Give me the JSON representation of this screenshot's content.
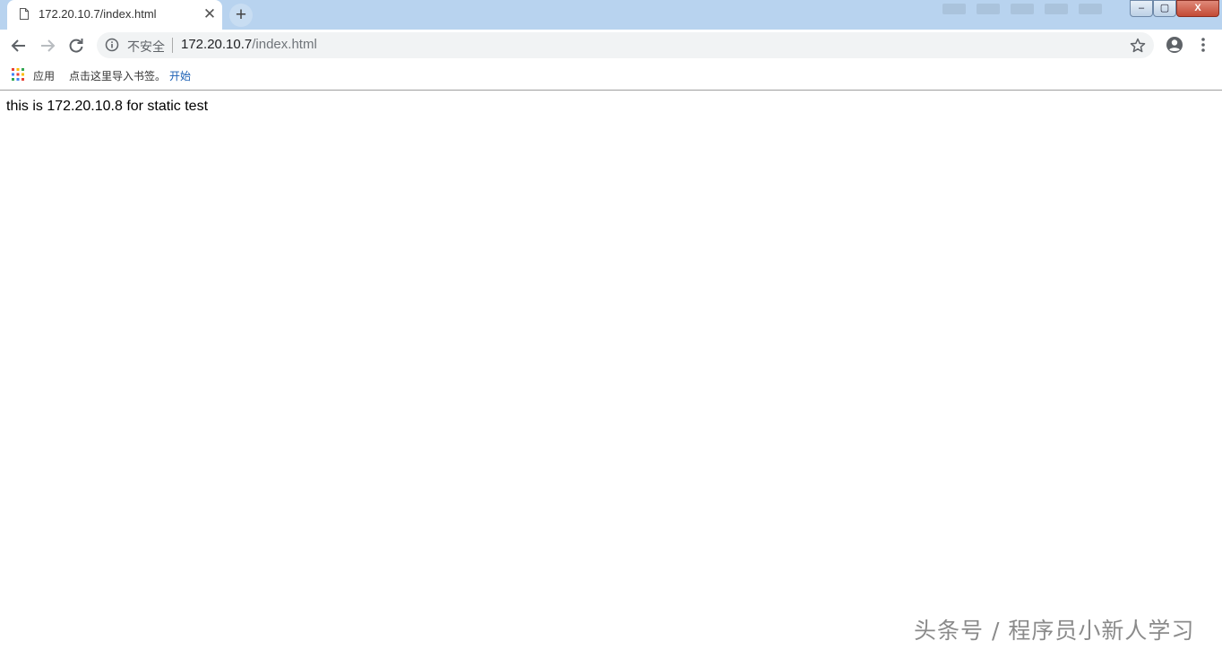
{
  "tab": {
    "title": "172.20.10.7/index.html",
    "close_glyph": "✕"
  },
  "new_tab_glyph": "+",
  "window_controls": {
    "minimize": "–",
    "maximize": "▢",
    "close": "X"
  },
  "omnibox": {
    "security_label": "不安全",
    "url_host": "172.20.10.7",
    "url_path": "/index.html"
  },
  "bookmarks": {
    "apps_label": "应用",
    "hint": "点击这里导入书签。",
    "start_link": "开始"
  },
  "page": {
    "text": "this is 172.20.10.8 for static test"
  },
  "watermark": "头条号 / 程序员小新人学习",
  "icons": [
    "page-icon",
    "close-icon",
    "plus-icon",
    "back-arrow-icon",
    "forward-arrow-icon",
    "reload-icon",
    "info-icon",
    "star-icon",
    "account-icon",
    "menu-dots-icon",
    "apps-grid-icon"
  ],
  "colors": {
    "tabstrip": "#b8d3ef",
    "omnibox": "#f1f3f4",
    "link": "#1a5fb4"
  }
}
